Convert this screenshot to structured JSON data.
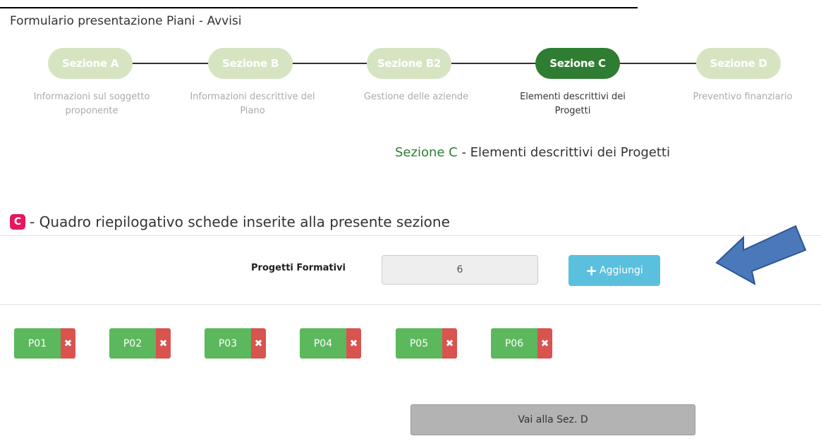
{
  "page": {
    "heading": "Formulario presentazione  Piani - Avvisi"
  },
  "wizard": {
    "steps": [
      {
        "label": "Sezione A",
        "description": "Informazioni sul soggetto proponente"
      },
      {
        "label": "Sezione B",
        "description": "Informazioni descrittive del Piano"
      },
      {
        "label": "Sezione B2",
        "description": "Gestione delle aziende"
      },
      {
        "label": "Sezione C",
        "description": "Elementi descrittivi dei Progetti"
      },
      {
        "label": "Sezione D",
        "description": "Preventivo finanziario"
      }
    ],
    "active_index": 3
  },
  "section_title": {
    "accent": "Sezione C",
    "rest": " -  Elementi descrittivi dei  Progetti"
  },
  "summary": {
    "badge": "C",
    "heading": "- Quadro riepilogativo schede inserite alla presente sezione",
    "projects_label": "Progetti  Formativi",
    "projects_count": "6",
    "add_button": "Aggiungi",
    "chips": [
      "P01",
      "P02",
      "P03",
      "P04",
      "P05",
      "P06"
    ],
    "delete_glyph": "✖",
    "next_button": "Vai alla Sez.  D"
  },
  "colors": {
    "step_inactive": "#d7e4c2",
    "step_active": "#2e7d32",
    "accent_green": "#2e7d32",
    "badge": "#e8155f",
    "add_button": "#5bc0de",
    "chip_green": "#5cb85c",
    "chip_red": "#d9534f",
    "arrow_fill": "#4a78b8"
  }
}
